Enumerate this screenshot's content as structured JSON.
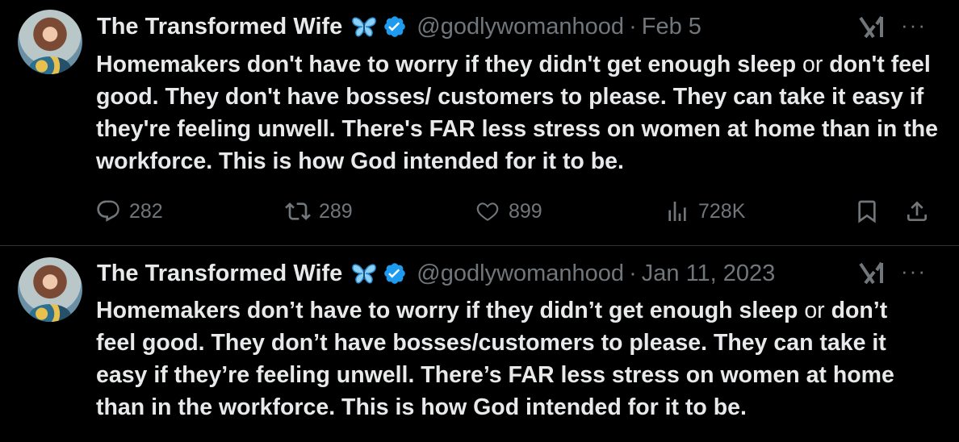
{
  "tweets": [
    {
      "author": {
        "name": "The Transformed Wife",
        "handle": "@godlywomanhood"
      },
      "separator": "·",
      "date": "Feb 5",
      "text_bold_1": "Homemakers don't have to worry if they didn't get enough sleep ",
      "text_plain": "or",
      "text_bold_2": " don't feel good. They don't have bosses/ customers to please. They can take it easy if they're feeling unwell. There's FAR less stress on women at home than in the workforce. This is how God intended for it to be.",
      "stats": {
        "replies": "282",
        "reposts": "289",
        "likes": "899",
        "views": "728K"
      },
      "more_label": "···"
    },
    {
      "author": {
        "name": "The Transformed Wife",
        "handle": "@godlywomanhood"
      },
      "separator": "·",
      "date": "Jan 11, 2023",
      "text_bold_1": "Homemakers don’t have to worry if they didn’t get enough sleep ",
      "text_plain": "or",
      "text_bold_2": " don’t feel good. They don’t have bosses/customers to please. They can take it easy if they’re feeling unwell. There’s FAR less stress on women at home than in the workforce. This is how God intended for it to be.",
      "more_label": "···"
    }
  ],
  "colors": {
    "background": "#000000",
    "text": "#e7e9ea",
    "muted": "#71767b",
    "verified": "#1d9bf0",
    "divider": "#2f3336"
  },
  "icons": [
    "butterfly-icon",
    "verified-badge-icon",
    "grok-icon",
    "more-icon",
    "reply-icon",
    "repost-icon",
    "like-icon",
    "views-icon",
    "bookmark-icon",
    "share-icon"
  ]
}
